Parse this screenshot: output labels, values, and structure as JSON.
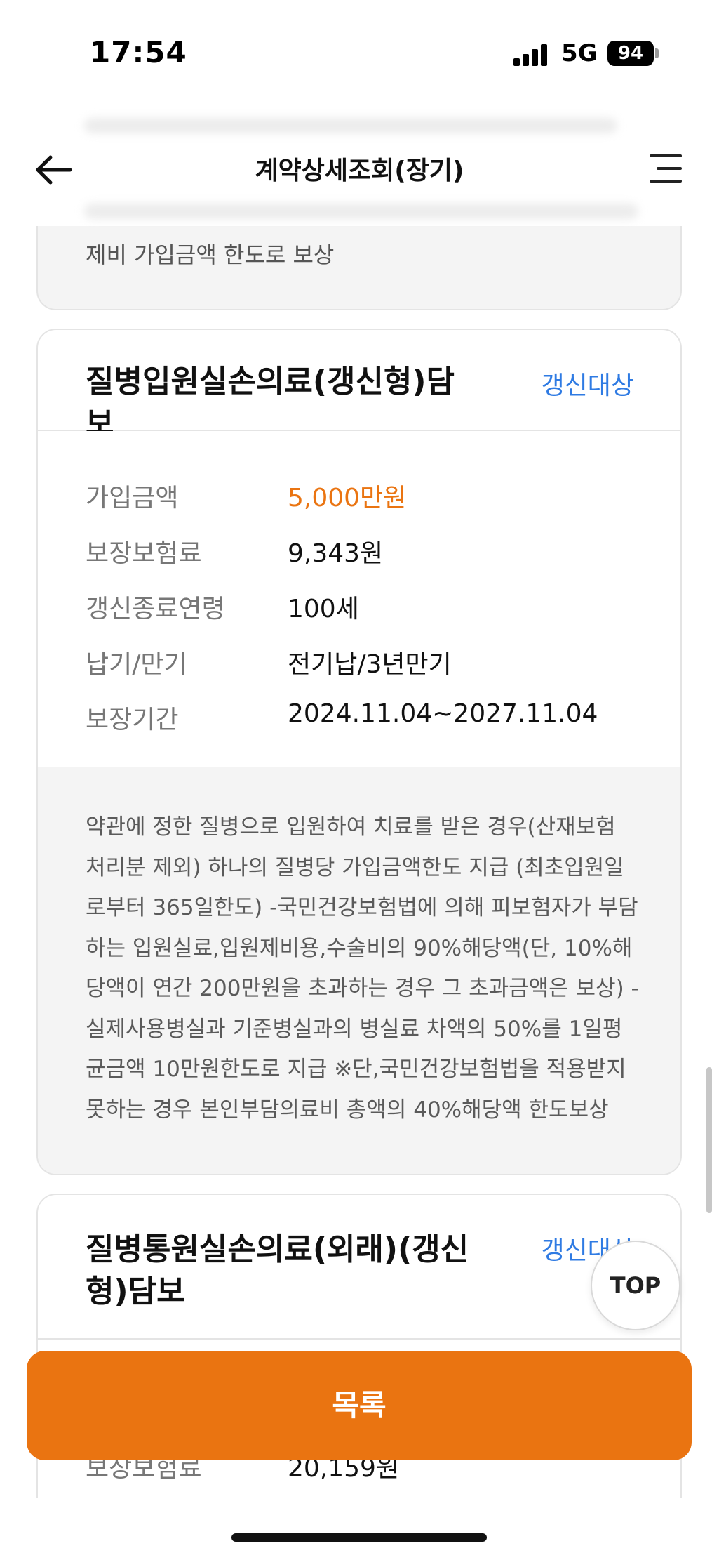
{
  "status_bar": {
    "time": "17:54",
    "network": "5G",
    "battery": "94"
  },
  "header": {
    "title": "계약상세조회(장기)"
  },
  "previous_card": {
    "text": "제비 가입금액 한도로 보상"
  },
  "coverage_1": {
    "title": "질병입원실손의료(갱신형)담보",
    "renew_label": "갱신대상",
    "rows": [
      {
        "label": "가입금액",
        "value": "5,000만원"
      },
      {
        "label": "보장보험료",
        "value": "9,343원"
      },
      {
        "label": "갱신종료연령",
        "value": "100세"
      },
      {
        "label": "납기/만기",
        "value": "전기납/3년만기"
      },
      {
        "label": "보장기간",
        "value": "2024.11.04~2027.11.04"
      }
    ],
    "description": "약관에 정한 질병으로 입원하여 치료를 받은 경우(산재보험 처리분 제외) 하나의 질병당 가입금액한도 지급 (최초입원일로부터 365일한도) -국민건강보험법에 의해 피보험자가 부담하는 입원실료,입원제비용,수술비의 90%해당액(단, 10%해당액이 연간 200만원을 초과하는 경우 그 초과금액은 보상) -실제사용병실과 기준병실과의 병실료 차액의 50%를 1일평균금액 10만원한도로 지급 ※단,국민건강보험법을 적용받지못하는 경우 본인부담의료비 총액의 40%해당액 한도보상"
  },
  "coverage_2": {
    "title": "질병통원실손의료(외래)(갱신형)담보",
    "renew_label": "갱신대상",
    "partial_label": "보장보험료",
    "partial_value": "20,159원"
  },
  "top_button": "TOP",
  "list_button": "목록"
}
